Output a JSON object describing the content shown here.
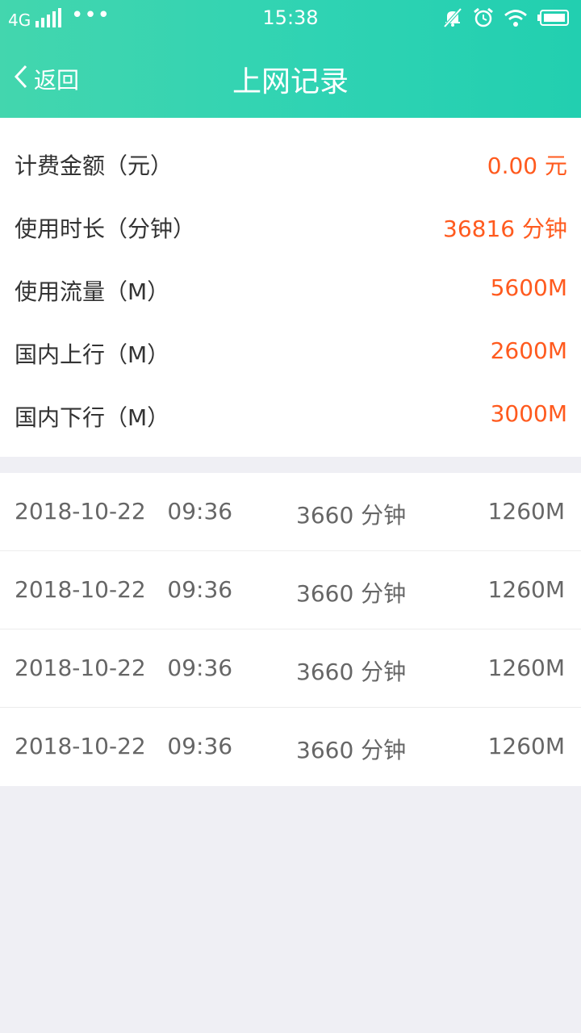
{
  "status_bar": {
    "network": "4G",
    "more": "•••",
    "time": "15:38",
    "icons": [
      "mute-icon",
      "alarm-icon",
      "wifi-icon",
      "battery-icon"
    ]
  },
  "nav": {
    "back_label": "返回",
    "title": "上网记录"
  },
  "summary": [
    {
      "label": "计费金额（元）",
      "value": "0.00 元"
    },
    {
      "label": "使用时长（分钟）",
      "value": "36816 分钟"
    },
    {
      "label": "使用流量（M）",
      "value": "5600M"
    },
    {
      "label": "国内上行（M）",
      "value": "2600M"
    },
    {
      "label": "国内下行（M）",
      "value": "3000M"
    }
  ],
  "records": [
    {
      "datetime": "2018-10-22   09:36",
      "duration": "3660 分钟",
      "flow": "1260M"
    },
    {
      "datetime": "2018-10-22   09:36",
      "duration": "3660 分钟",
      "flow": "1260M"
    },
    {
      "datetime": "2018-10-22   09:36",
      "duration": "3660 分钟",
      "flow": "1260M"
    },
    {
      "datetime": "2018-10-22   09:36",
      "duration": "3660 分钟",
      "flow": "1260M"
    }
  ],
  "colors": {
    "header_start": "#43d6ae",
    "header_end": "#22cfb0",
    "value_accent": "#ff5a1e",
    "page_bg": "#efeff4"
  }
}
